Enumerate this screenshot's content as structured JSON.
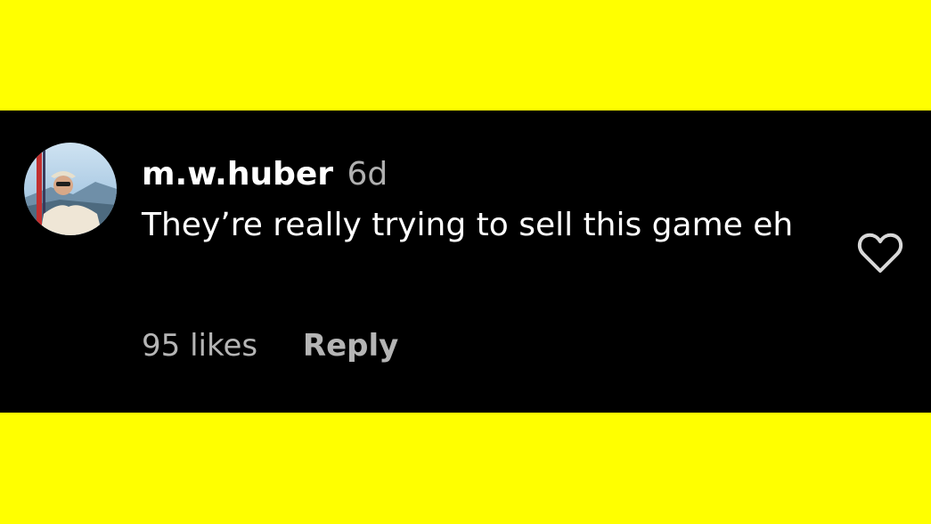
{
  "comment": {
    "username": "m.w.huber",
    "timestamp": "6d",
    "text": "They’re really trying to sell this game eh",
    "likes": "95 likes",
    "reply_label": "Reply",
    "like_icon": "heart-outline-icon"
  },
  "colors": {
    "background_band": "#ffff00",
    "panel": "#000000",
    "primary_text": "#ffffff",
    "secondary_text": "#b0b0b0"
  }
}
